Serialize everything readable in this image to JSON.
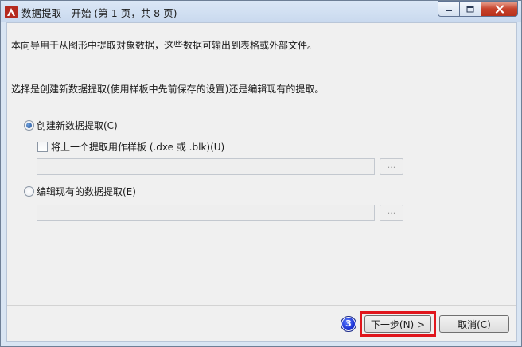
{
  "window": {
    "title": "数据提取 - 开始 (第 1 页，共 8 页)",
    "app_icon": "autocad-logo-icon",
    "accent_color": "#c0392b"
  },
  "content": {
    "intro_text": "本向导用于从图形中提取对象数据，这些数据可输出到表格或外部文件。",
    "choose_text": "选择是创建新数据提取(使用样板中先前保存的设置)还是编辑现有的提取。",
    "option_create": {
      "label": "创建新数据提取(C)",
      "selected": true
    },
    "template_checkbox": {
      "label": "将上一个提取用作样板  (.dxe 或 .blk)(U)",
      "checked": false
    },
    "template_path": {
      "value": ""
    },
    "template_browse_label": "...",
    "option_edit": {
      "label": "编辑现有的数据提取(E)",
      "selected": false
    },
    "edit_path": {
      "value": ""
    },
    "edit_browse_label": "..."
  },
  "footer": {
    "step_badge": "3",
    "next_label": "下一步(N) >",
    "cancel_label": "取消(C)",
    "highlight_color": "#e0161c"
  }
}
